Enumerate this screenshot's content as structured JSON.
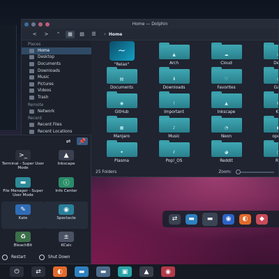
{
  "window": {
    "title": "Home — Dolphin",
    "breadcrumb": "Home",
    "traffic_colors": [
      "#3a6d9c",
      "#6c7892",
      "#b35f78",
      "#c25a7b"
    ]
  },
  "sidebar": {
    "sections": [
      {
        "heading": "Places",
        "items": [
          {
            "label": "Home",
            "icon": "home-icon",
            "selected": true
          },
          {
            "label": "Desktop",
            "icon": "desktop-icon"
          },
          {
            "label": "Documents",
            "icon": "documents-icon"
          },
          {
            "label": "Downloads",
            "icon": "downloads-icon"
          },
          {
            "label": "Music",
            "icon": "music-icon"
          },
          {
            "label": "Pictures",
            "icon": "pictures-icon"
          },
          {
            "label": "Videos",
            "icon": "videos-icon"
          },
          {
            "label": "Trash",
            "icon": "trash-icon"
          }
        ]
      },
      {
        "heading": "Remote",
        "items": [
          {
            "label": "Network",
            "icon": "network-icon"
          }
        ]
      },
      {
        "heading": "Recent",
        "items": [
          {
            "label": "Recent Files",
            "icon": "recent-files-icon"
          },
          {
            "label": "Recent Locations",
            "icon": "recent-locations-icon"
          }
        ]
      }
    ]
  },
  "files": [
    {
      "name": "\"Relax\"",
      "kind": "image",
      "glyph": "~"
    },
    {
      "name": "Arch",
      "kind": "folder",
      "glyph": "▲"
    },
    {
      "name": "Cloud",
      "kind": "folder",
      "glyph": "☁"
    },
    {
      "name": "Desk",
      "kind": "folder",
      "glyph": "▭"
    },
    {
      "name": "Documents",
      "kind": "folder",
      "glyph": "▤"
    },
    {
      "name": "Downloads",
      "kind": "folder",
      "glyph": "⬇"
    },
    {
      "name": "Favorites",
      "kind": "folder",
      "glyph": "♡"
    },
    {
      "name": "Gam",
      "kind": "folder",
      "glyph": "◎"
    },
    {
      "name": "GitHub",
      "kind": "folder",
      "glyph": "◉"
    },
    {
      "name": "Important",
      "kind": "folder",
      "glyph": "!"
    },
    {
      "name": "Inkscape",
      "kind": "folder",
      "glyph": "▲"
    },
    {
      "name": "KD",
      "kind": "folder",
      "glyph": "⚙"
    },
    {
      "name": "Manjaro",
      "kind": "folder",
      "glyph": "▦"
    },
    {
      "name": "Music",
      "kind": "folder",
      "glyph": "♪"
    },
    {
      "name": "Neon",
      "kind": "folder",
      "glyph": "◔"
    },
    {
      "name": "openS",
      "kind": "folder",
      "glyph": "◐"
    },
    {
      "name": "Plasma",
      "kind": "folder",
      "glyph": "✦"
    },
    {
      "name": "Pop!_OS",
      "kind": "folder",
      "glyph": "ℓ"
    },
    {
      "name": "Reddit",
      "kind": "folder",
      "glyph": "◕"
    },
    {
      "name": "Rel",
      "kind": "folder",
      "glyph": "▢"
    }
  ],
  "status": {
    "folders": "25 Folders",
    "zoom_label": "Zoom:",
    "zoom_level": 0.0
  },
  "launcher": {
    "apps": [
      {
        "name": "Terminal - Super User Mode",
        "icon": "terminal-icon",
        "glyph": ">_",
        "color": "#2b2f3a"
      },
      {
        "name": "Inkscape",
        "icon": "inkscape-icon",
        "glyph": "▲",
        "color": "#3a4050"
      },
      {
        "name": "File Manager - Super User Mode",
        "icon": "folder-icon",
        "glyph": "▬",
        "color": "#2d8a98"
      },
      {
        "name": "Info Center",
        "icon": "info-center-icon",
        "glyph": "ⓘ",
        "color": "#2a8c68"
      },
      {
        "name": "Kate",
        "icon": "kate-icon",
        "glyph": "✎",
        "color": "#2f6cb6"
      },
      {
        "name": "Spectacle",
        "icon": "spectacle-icon",
        "glyph": "◉",
        "color": "#2a7f9a"
      },
      {
        "name": "BleachBit",
        "icon": "bleachbit-icon",
        "glyph": "♻",
        "color": "#3c6f4a"
      },
      {
        "name": "KCalc",
        "icon": "kcalc-icon",
        "glyph": "±",
        "color": "#4a5263"
      }
    ],
    "restart_label": "Restart",
    "shutdown_label": "Shut Down"
  },
  "dock": [
    {
      "icon": "sliders-icon",
      "glyph": "⇄",
      "color": "#3b4252"
    },
    {
      "icon": "dolphin-icon",
      "glyph": "▬",
      "color": "#2e7fbf"
    },
    {
      "icon": "folder-icon",
      "glyph": "▬",
      "color": "#4a5568",
      "active": true
    },
    {
      "icon": "chromium-icon",
      "glyph": "◉",
      "color": "#2b63c7"
    },
    {
      "icon": "firefox-icon",
      "glyph": "◐",
      "color": "#e26a2c"
    },
    {
      "icon": "app-icon",
      "glyph": "◆",
      "color": "#c84a5a"
    }
  ],
  "taskbar": [
    {
      "icon": "power-icon",
      "glyph": "⏻",
      "color": "#2a2f3b"
    },
    {
      "icon": "sliders-icon",
      "glyph": "⇄",
      "color": "#2a2f3b"
    },
    {
      "icon": "firefox-icon",
      "glyph": "◐",
      "color": "#e26a2c"
    },
    {
      "icon": "dolphin-icon",
      "glyph": "▬",
      "color": "#2e7fbf"
    },
    {
      "icon": "folder-icon",
      "glyph": "▬",
      "color": "#4b6a8a"
    },
    {
      "icon": "system-monitor-icon",
      "glyph": "▣",
      "color": "#2aa3a8"
    },
    {
      "icon": "inkscape-icon",
      "glyph": "▲",
      "color": "#3b3f4b"
    },
    {
      "icon": "eye-icon",
      "glyph": "◉",
      "color": "#b33a4a"
    }
  ]
}
